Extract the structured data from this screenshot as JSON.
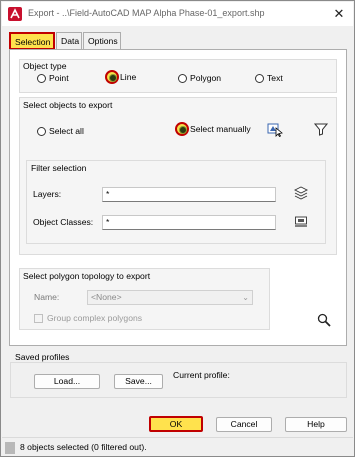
{
  "window": {
    "title": "Export - ..\\Field-AutoCAD MAP Alpha Phase-01_export.shp",
    "close_glyph": "✕"
  },
  "tabs": [
    {
      "label": "Selection",
      "active": true
    },
    {
      "label": "Data",
      "active": false
    },
    {
      "label": "Options",
      "active": false
    }
  ],
  "object_type": {
    "label": "Object type",
    "options": [
      {
        "label": "Point",
        "selected": false
      },
      {
        "label": "Line",
        "selected": true
      },
      {
        "label": "Polygon",
        "selected": false
      },
      {
        "label": "Text",
        "selected": false
      }
    ]
  },
  "select_objects": {
    "label": "Select objects to export",
    "select_all": "Select all",
    "select_manually": "Select manually",
    "selected_option": "Select manually"
  },
  "filter_selection": {
    "label": "Filter selection",
    "layers_label": "Layers:",
    "layers_value": "*",
    "object_classes_label": "Object Classes:",
    "object_classes_value": "*"
  },
  "polygon_topology": {
    "label": "Select polygon topology to export",
    "name_label": "Name:",
    "name_value": "<None>",
    "group_complex_label": "Group complex polygons",
    "group_complex_checked": false
  },
  "saved_profiles": {
    "label": "Saved profiles",
    "load_label": "Load...",
    "save_label": "Save...",
    "current_profile_label": "Current profile:",
    "current_profile_value": ""
  },
  "buttons": {
    "ok": "OK",
    "cancel": "Cancel",
    "help": "Help"
  },
  "status": {
    "text": "8 objects selected (0 filtered out)."
  },
  "colors": {
    "highlight_fill": "#ffe24d",
    "highlight_border": "#c00000",
    "dialog_bg": "#f0f0f0"
  },
  "icons": {
    "app": "autocad-app-icon",
    "select_objects": "select-objects-icon",
    "quick_select_filter": "filter-funnel-icon",
    "layers": "layers-icon",
    "object_classes": "object-classes-icon",
    "zoom": "magnifier-icon"
  }
}
